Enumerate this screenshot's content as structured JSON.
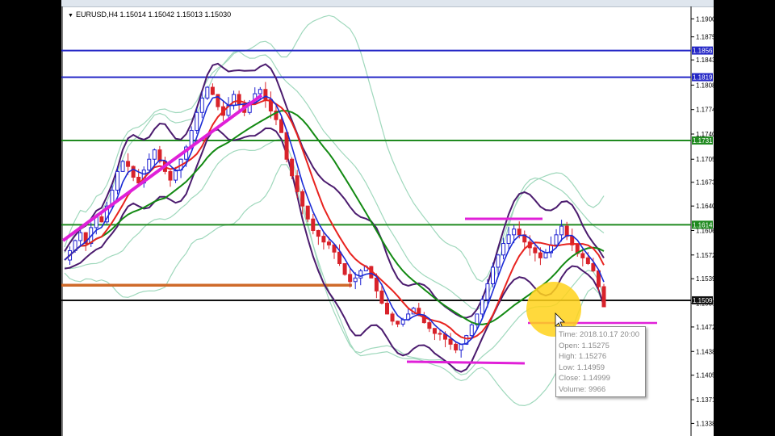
{
  "window": {
    "symbol_arrow": "▼",
    "symbol_text": "EURUSD,H4  1.15014 1.15042 1.15013 1.15030"
  },
  "tooltip": {
    "time": "Time: 2018.10.17 20:00",
    "open": "Open: 1.15275",
    "high": "High: 1.15276",
    "low": "Low:  1.14959",
    "close": "Close: 1.14999",
    "volume": "Volume: 9966"
  },
  "colors": {
    "candle": "#1d1fd1",
    "red_line": "#e8231f",
    "blue_line": "#1a2bd6",
    "green_ma": "#138a13",
    "envelope": "#4b1b6e",
    "bollinger": "#9fd8bc",
    "magenta": "#e020d8",
    "orange": "#cf6a2a",
    "hl_blue": "#2427c6",
    "hl_green": "#208a20",
    "hl_black": "#111111",
    "highlight": "#ffd21a"
  },
  "chart_data": {
    "type": "line",
    "ylim": [
      1.1325,
      1.1915
    ],
    "y_ticks": [
      "1.1900",
      "1.1875",
      "1.1843",
      "1.1808",
      "1.1774",
      "1.1740",
      "1.1705",
      "1.1673",
      "1.1640",
      "1.1606",
      "1.1572",
      "1.1539",
      "1.1505",
      "1.1472",
      "1.1438",
      "1.1405",
      "1.1371",
      "1.1338"
    ],
    "horizontal_levels": [
      {
        "price": 1.1856,
        "label": "1.1856",
        "color": "#2427c6"
      },
      {
        "price": 1.1819,
        "label": "1.1819",
        "color": "#2427c6"
      },
      {
        "price": 1.1731,
        "label": "1.1731",
        "color": "#208a20"
      },
      {
        "price": 1.1614,
        "label": "1.1614",
        "color": "#208a20"
      },
      {
        "price": 1.1509,
        "label": "1.1509",
        "color": "#111111"
      }
    ],
    "close_series": [
      1.1565,
      1.1578,
      1.1592,
      1.1603,
      1.1588,
      1.161,
      1.1625,
      1.1618,
      1.164,
      1.1662,
      1.1688,
      1.1702,
      1.1695,
      1.168,
      1.1672,
      1.169,
      1.1705,
      1.1718,
      1.1702,
      1.1688,
      1.1676,
      1.169,
      1.1705,
      1.1722,
      1.1745,
      1.177,
      1.179,
      1.1805,
      1.1795,
      1.1778,
      1.1766,
      1.178,
      1.1795,
      1.1782,
      1.177,
      1.1784,
      1.1796,
      1.1802,
      1.1788,
      1.1772,
      1.176,
      1.1742,
      1.1705,
      1.1682,
      1.166,
      1.164,
      1.1622,
      1.1606,
      1.1598,
      1.159,
      1.1586,
      1.1576,
      1.156,
      1.1545,
      1.1535,
      1.154,
      1.155,
      1.1556,
      1.154,
      1.1522,
      1.1505,
      1.149,
      1.148,
      1.1476,
      1.1482,
      1.149,
      1.1498,
      1.1488,
      1.1478,
      1.147,
      1.1463,
      1.1462,
      1.1455,
      1.1448,
      1.144,
      1.1448,
      1.146,
      1.1475,
      1.149,
      1.151,
      1.1532,
      1.1555,
      1.1572,
      1.1588,
      1.16,
      1.1608,
      1.16,
      1.159,
      1.1582,
      1.1575,
      1.1568,
      1.1575,
      1.1586,
      1.16,
      1.1612,
      1.1598,
      1.1586,
      1.1574,
      1.1568,
      1.156,
      1.155,
      1.1528,
      1.15
    ]
  }
}
